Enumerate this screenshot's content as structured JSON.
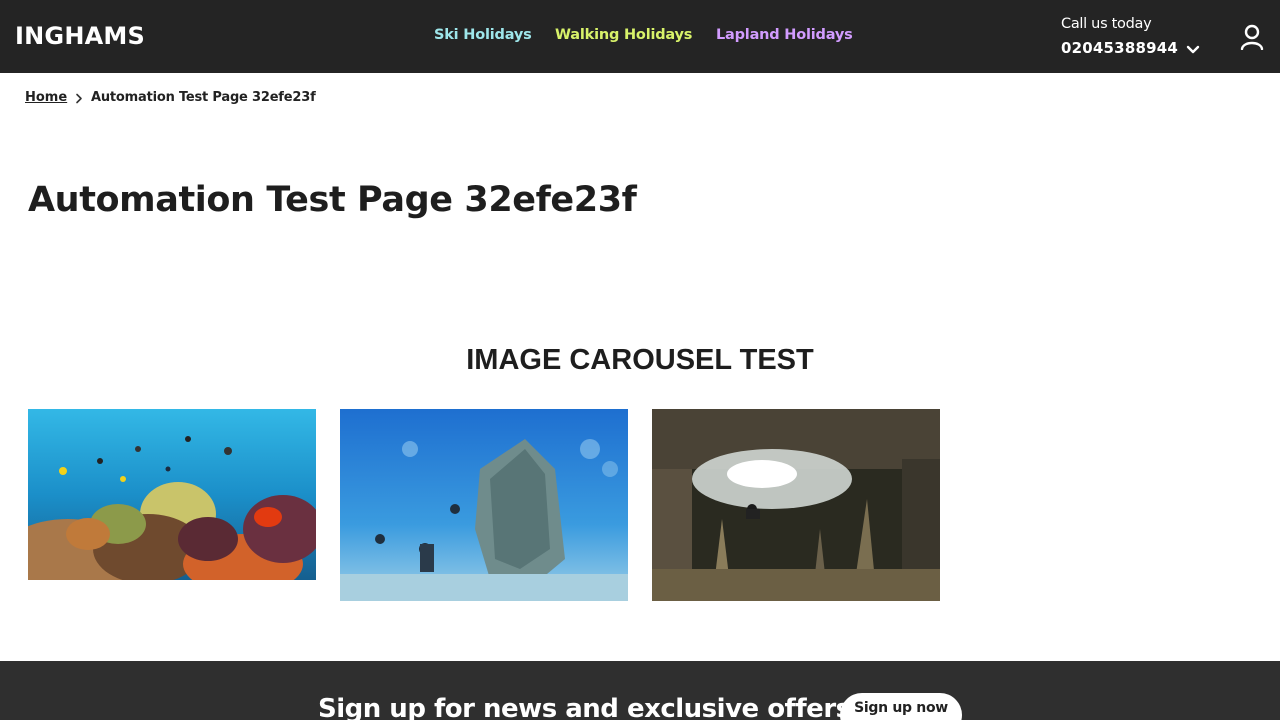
{
  "header": {
    "logo": "INGHAMS",
    "nav": [
      {
        "label": "Ski Holidays",
        "color": "#9ee6ea"
      },
      {
        "label": "Walking Holidays",
        "color": "#d8f26a"
      },
      {
        "label": "Lapland Holidays",
        "color": "#d29cff"
      }
    ],
    "call_label": "Call us today",
    "phone": "02045388944",
    "icons": {
      "phone_toggle": "chevron-down-icon",
      "account": "user-icon"
    }
  },
  "breadcrumb": {
    "home": "Home",
    "separator_icon": "chevron-right-icon",
    "current": "Automation Test Page 32efe23f"
  },
  "page_title": "Automation Test Page 32efe23f",
  "carousel": {
    "title": "IMAGE CAROUSEL TEST",
    "slides": [
      {
        "subject": "coral reef with tropical fish"
      },
      {
        "subject": "divers exploring a shipwreck"
      },
      {
        "subject": "diver in an underwater cave"
      }
    ]
  },
  "footer": {
    "signup_text": "Sign up for news and exclusive offers",
    "signup_button": "Sign up now"
  },
  "colors": {
    "header_bg": "#242424",
    "footer_bg": "#2f2f2f",
    "text": "#1e1e1e"
  }
}
